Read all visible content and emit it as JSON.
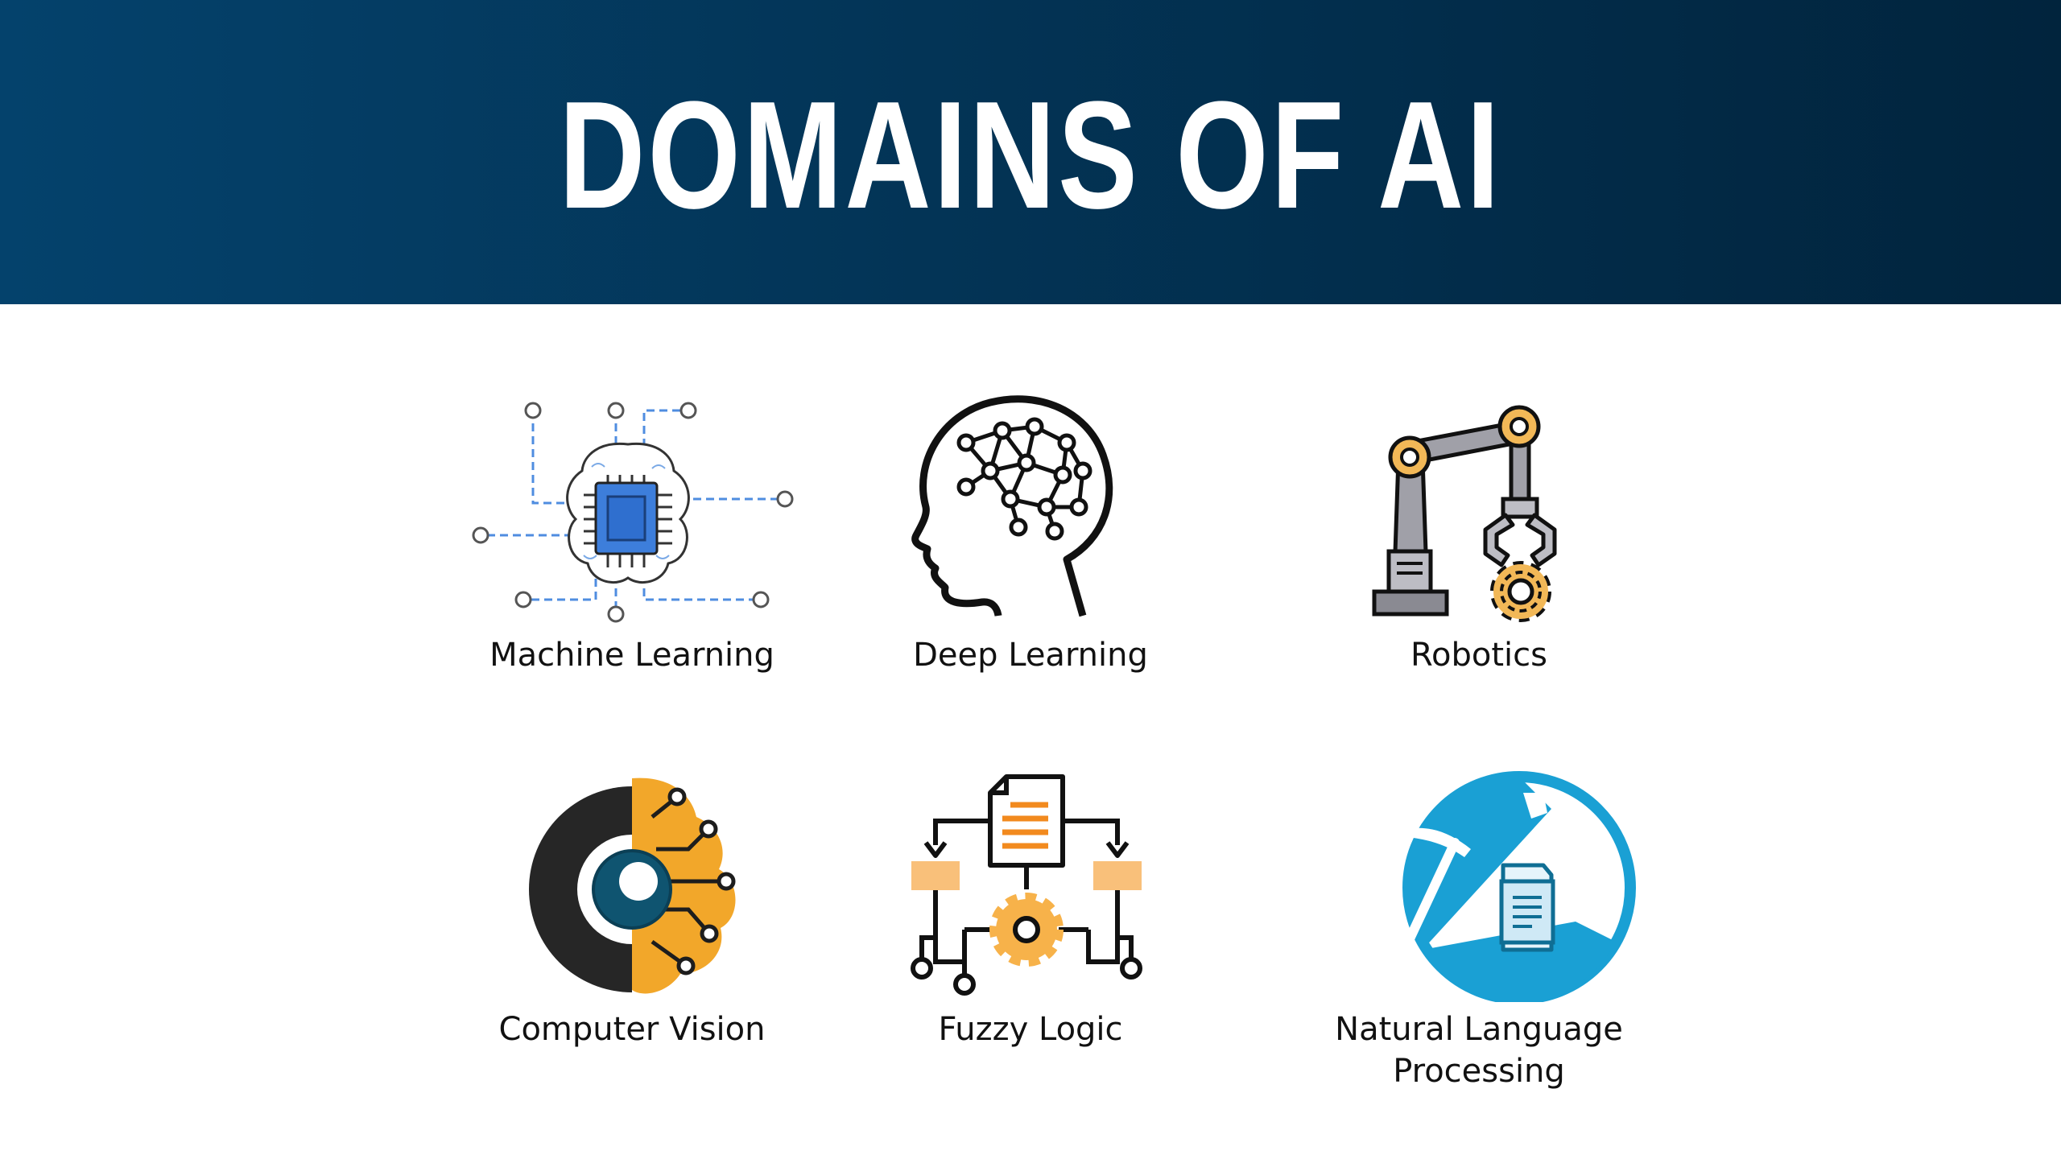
{
  "slide": {
    "title": "DOMAINS OF AI",
    "domains": [
      {
        "label": "Machine Learning",
        "icon": "chip-brain-icon"
      },
      {
        "label": "Deep Learning",
        "icon": "neural-head-icon"
      },
      {
        "label": "Robotics",
        "icon": "robot-arm-icon"
      },
      {
        "label": "Computer Vision",
        "icon": "gear-eye-brain-icon"
      },
      {
        "label": "Fuzzy Logic",
        "icon": "document-flow-gear-icon"
      },
      {
        "label": "Natural Language Processing",
        "icon": "pickaxe-document-icon"
      }
    ]
  },
  "colors": {
    "header_dark": "#01243d",
    "header_light": "#04426c",
    "accent_blue": "#4f8de0",
    "accent_orange": "#f2a72a",
    "nlp_blue": "#1aa0d4",
    "vision_teal": "#0f5470"
  }
}
